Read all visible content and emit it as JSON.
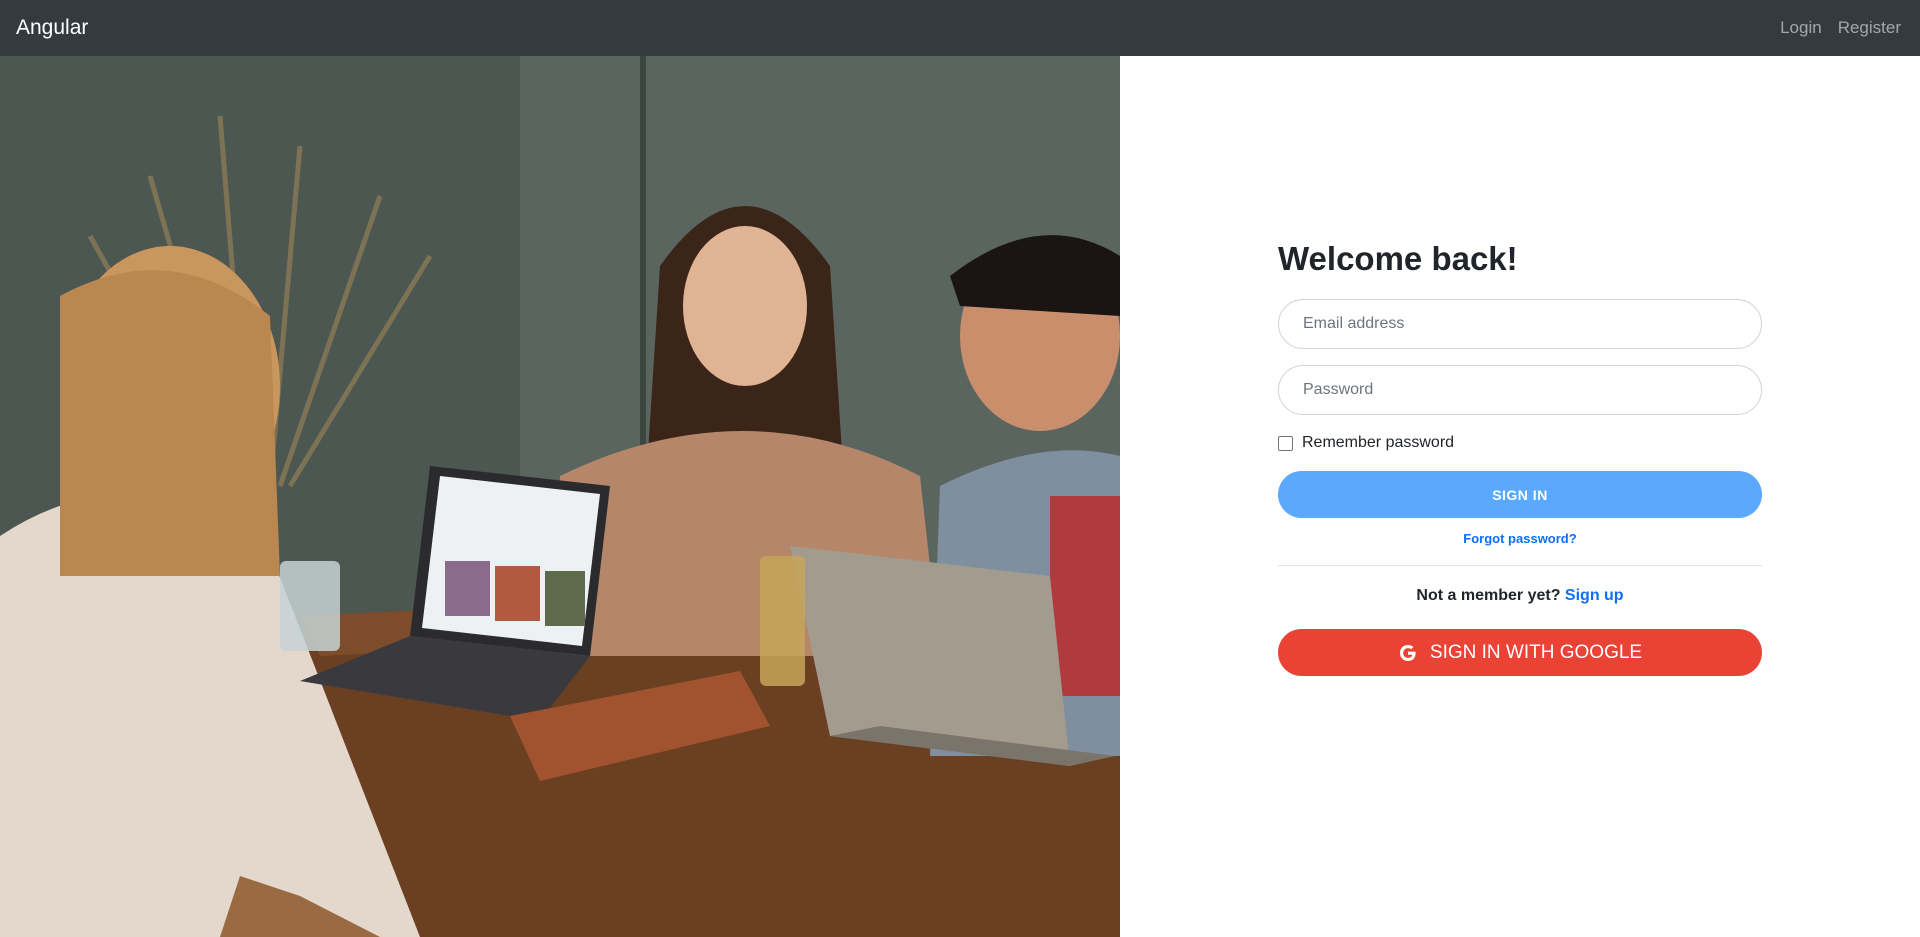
{
  "navbar": {
    "brand": "Angular",
    "links": [
      "Login",
      "Register"
    ]
  },
  "form": {
    "title": "Welcome back!",
    "email_placeholder": "Email address",
    "password_placeholder": "Password",
    "remember_label": "Remember password",
    "signin_label": "SIGN IN",
    "forgot_label": "Forgot password?",
    "not_member_text": "Not a member yet?",
    "signup_label": "Sign up",
    "google_label": "SIGN IN WITH GOOGLE"
  },
  "colors": {
    "navbar_bg": "#343a40",
    "signin_button": "#5aa9ff",
    "google_button": "#ea4335",
    "link": "#0d6efd"
  },
  "icons": {
    "google": "google-g-icon"
  },
  "hero": {
    "description_icon": "hero-photo"
  }
}
